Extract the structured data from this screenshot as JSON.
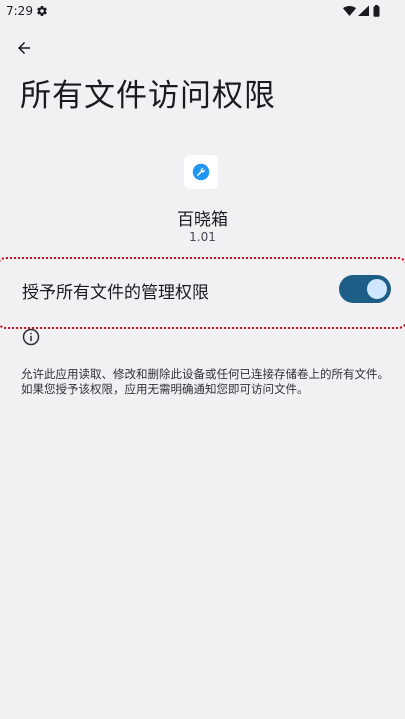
{
  "status_bar": {
    "time": "7:29",
    "gear_icon": "gear-icon",
    "wifi_icon": "wifi-icon",
    "signal_icon": "signal-icon",
    "battery_icon": "battery-icon"
  },
  "header": {
    "back_icon": "arrow-left-icon",
    "title": "所有文件访问权限"
  },
  "app": {
    "name": "百晓箱",
    "version": "1.01",
    "icon": "app-wrench-icon"
  },
  "permission": {
    "label": "授予所有文件的管理权限",
    "enabled": true
  },
  "info": {
    "icon": "info-icon",
    "description": "允许此应用读取、修改和删除此设备或任何已连接存储卷上的所有文件。如果您授予该权限，应用无需明确通知您即可访问文件。"
  },
  "colors": {
    "background": "#f1f1f4",
    "switch_track": "#1e5e86",
    "switch_thumb": "#cfe6ff",
    "highlight_border": "#d10a1a",
    "app_icon_blue": "#2196f3"
  }
}
